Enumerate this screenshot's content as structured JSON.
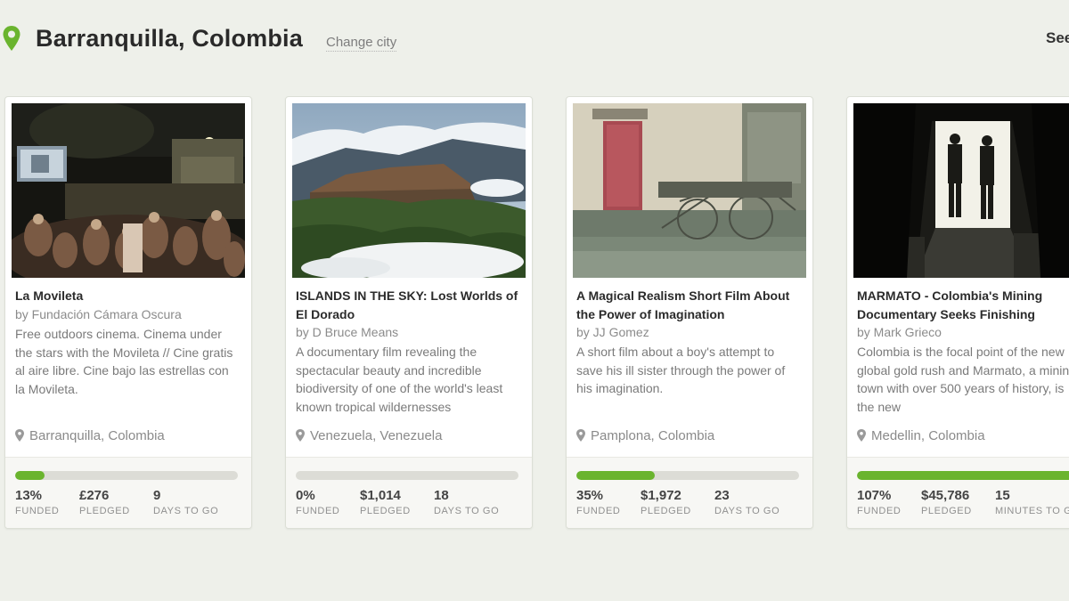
{
  "header": {
    "city": "Barranquilla, Colombia",
    "change_city": "Change city",
    "see_all": "See"
  },
  "colors": {
    "accent": "#6ab42e",
    "pin": "#6ab42e"
  },
  "cards": [
    {
      "title": "La Movileta",
      "creator": "by Fundación Cámara Oscura",
      "blurb": "Free outdoors cinema. Cinema under the stars with the Movileta // Cine gratis al aire libre. Cine bajo las estrellas con la Movileta.",
      "location": "Barranquilla, Colombia",
      "progress": 0.13,
      "stats": [
        {
          "value": "13%",
          "label": "FUNDED"
        },
        {
          "value": "£276",
          "label": "PLEDGED"
        },
        {
          "value": "9",
          "label": "DAYS TO GO"
        }
      ]
    },
    {
      "title": "ISLANDS IN THE SKY: Lost Worlds of El Dorado",
      "creator": "by D Bruce Means",
      "blurb": "A documentary film revealing the spectacular beauty and incredible biodiversity of one of the world's least known tropical wildernesses",
      "location": "Venezuela, Venezuela",
      "progress": 0.0,
      "stats": [
        {
          "value": "0%",
          "label": "FUNDED"
        },
        {
          "value": "$1,014",
          "label": "PLEDGED"
        },
        {
          "value": "18",
          "label": "DAYS TO GO"
        }
      ]
    },
    {
      "title": "A Magical Realism Short Film About the Power of Imagination",
      "creator": "by JJ Gomez",
      "blurb": "A short film about a boy's attempt to save his ill sister through the power of his imagination.",
      "location": "Pamplona, Colombia",
      "progress": 0.35,
      "stats": [
        {
          "value": "35%",
          "label": "FUNDED"
        },
        {
          "value": "$1,972",
          "label": "PLEDGED"
        },
        {
          "value": "23",
          "label": "DAYS TO GO"
        }
      ]
    },
    {
      "title": "MARMATO - Colombia's Mining Documentary Seeks Finishing",
      "creator": "by Mark Grieco",
      "blurb": "Colombia is the focal point of the new global gold rush and Marmato, a mining town with over 500 years of history, is the new",
      "location": "Medellin, Colombia",
      "progress": 1.0,
      "stats": [
        {
          "value": "107%",
          "label": "FUNDED"
        },
        {
          "value": "$45,786",
          "label": "PLEDGED"
        },
        {
          "value": "15",
          "label": "MINUTES TO GO"
        }
      ]
    }
  ]
}
